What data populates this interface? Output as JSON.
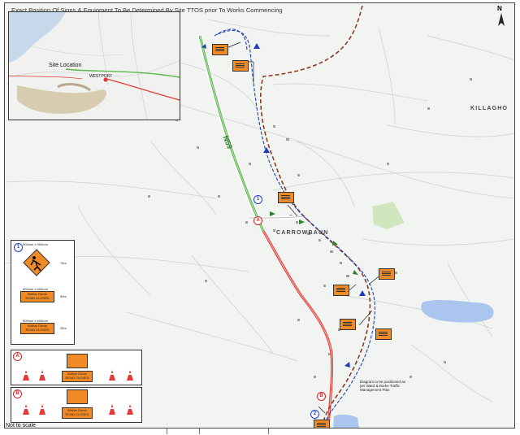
{
  "title": "Exact Position Of Signs & Equipment To Be Determined By Site TTOS prior To Works Commencing",
  "places": {
    "killaghoo": "KILLAGHO",
    "carrowbaun": "CARROWBAUN"
  },
  "road": {
    "n59": "N59"
  },
  "inset": {
    "site_location": "Site Location",
    "town": "WESTPORT"
  },
  "north": "N",
  "markers": {
    "one": "1",
    "a": "A",
    "b": "B",
    "two": "2"
  },
  "legend": {
    "row1": {
      "size": "900mm x 900mm",
      "dist": "75m"
    },
    "row2": {
      "size": "900mm x 600mm",
      "dist": "50m"
    },
    "row3": {
      "size": "900mm x 600mm",
      "dist": "25m"
    },
    "sign_road_closed": "ROAD CLOSED",
    "sign_bothar_duinta": "Bóthar Dúnta"
  },
  "note": "Diagram to be positioned as per Ward & Burke Traffic Management Plan",
  "not_to_scale": "Not to scale",
  "colors": {
    "green_road": "#59b84a",
    "red_road": "#e53935",
    "route_blue": "#1e3fbf",
    "route_brown": "#8d3a20",
    "sign": "#f08a24"
  }
}
